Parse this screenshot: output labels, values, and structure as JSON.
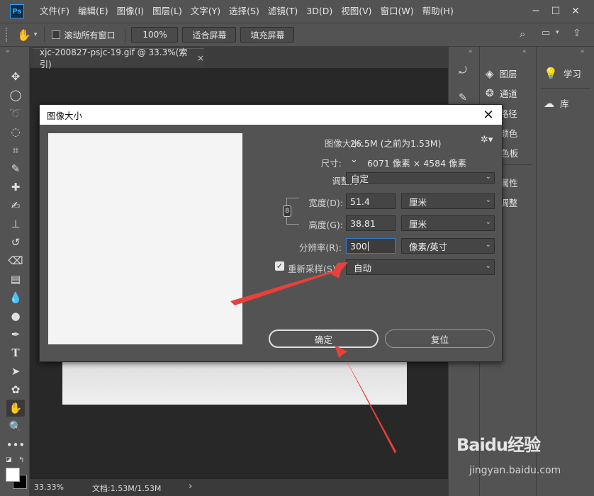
{
  "app": {
    "logo": "Ps"
  },
  "menu": [
    "文件(F)",
    "编辑(E)",
    "图像(I)",
    "图层(L)",
    "文字(Y)",
    "选择(S)",
    "滤镜(T)",
    "3D(D)",
    "视图(V)",
    "窗口(W)",
    "帮助(H)"
  ],
  "options": {
    "scroll_all_label": "滚动所有窗口",
    "zoom_label": "100%",
    "fit_screen_label": "适合屏幕",
    "fill_screen_label": "填充屏幕"
  },
  "document": {
    "tab_title": "xjc-200827-psjc-19.gif @ 33.3%(索引)",
    "tab_close": "×",
    "status_zoom": "33.33%",
    "status_doc": "文档:1.53M/1.53M",
    "status_arrow": "›"
  },
  "panels": {
    "layers": "图层",
    "channels": "通道",
    "paths": "路径",
    "color": "颜色",
    "swatches": "色板",
    "properties": "属性",
    "adjustments": "调整",
    "learn": "学习",
    "libraries": "库"
  },
  "dialog": {
    "title": "图像大小",
    "close": "✕",
    "image_size_label": "图像大小:",
    "image_size_value": "26.5M (之前为1.53M)",
    "dimensions_label": "尺寸:",
    "dimensions_value": "6071 像素  ×  4584 像素",
    "fit_to_label": "调整为:",
    "fit_to_value": "自定",
    "width_label": "宽度(D):",
    "width_value": "51.4",
    "width_unit": "厘米",
    "height_label": "高度(G):",
    "height_value": "38.81",
    "height_unit": "厘米",
    "resolution_label": "分辨率(R):",
    "resolution_value": "300",
    "resolution_unit": "像素/英寸",
    "resample_label": "重新采样(S):",
    "resample_value": "自动",
    "ok_label": "确定",
    "reset_label": "复位"
  },
  "watermark": {
    "brand": "Baidu经验",
    "url": "jingyan.baidu.com"
  },
  "colors": {
    "accent_blue": "#2d7fd3",
    "annotation_red": "#e8403a",
    "ui_bg": "#535353",
    "canvas_bg": "#282828"
  }
}
